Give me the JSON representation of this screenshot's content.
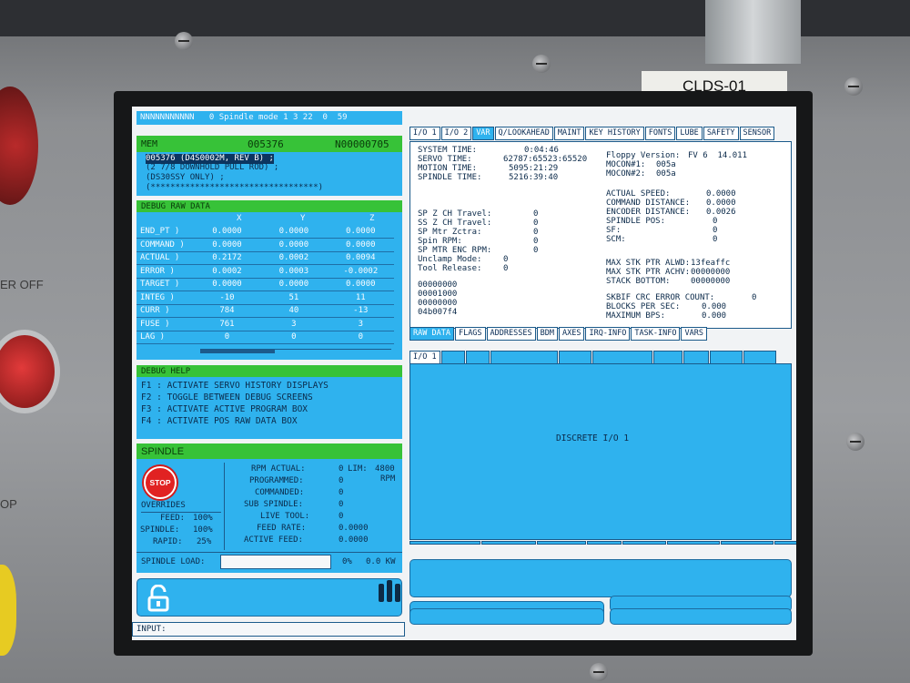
{
  "machine_label": "CLDS-01",
  "external": {
    "side_text_1": "ER OFF",
    "side_text_2": "OP"
  },
  "status_bar": {
    "text": "NNNNNNNNNNN   0 Spindle mode 1 3 22  0  59"
  },
  "program": {
    "mode": "MEM",
    "program_number": "005376",
    "block_number": "N00000705",
    "lines": [
      "005376 (D4S0002M, REV B) ;",
      "(2 7/8 DOWNHOLD PULL ROD) ;",
      "(DS30SSY ONLY) ;",
      "(**********************************)"
    ]
  },
  "debug_raw": {
    "title": "DEBUG RAW DATA",
    "columns": [
      "X",
      "Y",
      "Z"
    ],
    "rows": [
      {
        "label": "END_PT  )",
        "x": "0.0000",
        "y": "0.0000",
        "z": "0.0000"
      },
      {
        "label": "COMMAND )",
        "x": "0.0000",
        "y": "0.0000",
        "z": "0.0000"
      },
      {
        "label": "ACTUAL  )",
        "x": "0.2172",
        "y": "0.0002",
        "z": "0.0094"
      },
      {
        "label": "ERROR   )",
        "x": "0.0002",
        "y": "0.0003",
        "z": "-0.0002"
      },
      {
        "label": "TARGET  )",
        "x": "0.0000",
        "y": "0.0000",
        "z": "0.0000"
      },
      {
        "label": "INTEG   )",
        "x": "-10",
        "y": "51",
        "z": "11"
      },
      {
        "label": "CURR    )",
        "x": "784",
        "y": "40",
        "z": "-13"
      },
      {
        "label": "FUSE    )",
        "x": "761",
        "y": "3",
        "z": "3"
      },
      {
        "label": "LAG     )",
        "x": "0",
        "y": "0",
        "z": "0"
      }
    ]
  },
  "debug_help": {
    "title": "DEBUG HELP",
    "lines": [
      "F1 : ACTIVATE SERVO HISTORY DISPLAYS",
      "F2 : TOGGLE BETWEEN DEBUG SCREENS",
      "F3 : ACTIVATE ACTIVE PROGRAM BOX",
      "F4 : ACTIVATE POS RAW DATA BOX"
    ]
  },
  "spindle": {
    "title": "SPINDLE",
    "stop_label": "STOP",
    "overrides_label": "OVERRIDES",
    "feed_label": "FEED:",
    "feed_value": "100%",
    "spindle_label": "SPINDLE:",
    "spindle_value": "100%",
    "rapid_label": "RAPID:",
    "rapid_value": "25%",
    "rpm_actual_label": "RPM ACTUAL:",
    "rpm_actual_value": "0",
    "lim_label": "LIM:",
    "lim_value": "4800",
    "rpm_unit": "RPM",
    "programmed_label": "PROGRAMMED:",
    "programmed_value": "0",
    "commanded_label": "COMMANDED:",
    "commanded_value": "0",
    "sub_spindle_label": "SUB SPINDLE:",
    "sub_spindle_value": "0",
    "live_tool_label": "LIVE TOOL:",
    "live_tool_value": "0",
    "feed_rate_label": "FEED RATE:",
    "feed_rate_value": "0.0000",
    "active_feed_label": "ACTIVE FEED:",
    "active_feed_value": "0.0000",
    "load_label": "SPINDLE LOAD:",
    "load_percent": "0%",
    "load_kw": "0.0 KW"
  },
  "input": {
    "label": "INPUT:"
  },
  "var_tabs": [
    "I/O 1",
    "I/O 2",
    "VAR",
    "Q/LOOKAHEAD",
    "MAINT",
    "KEY HISTORY",
    "FONTS",
    "LUBE",
    "SAFETY",
    "SENSOR"
  ],
  "var_panel": {
    "system_time_label": "SYSTEM TIME:",
    "system_time": "0:04:46",
    "servo_time_label": "SERVO TIME:",
    "servo_time": "62787:65523:65520",
    "motion_time_label": "MOTION TIME:",
    "motion_time": "5095:21:29",
    "spindle_time_label": "SPINDLE TIME:",
    "spindle_time": "5216:39:40",
    "floppy_label": "Floppy Version:",
    "floppy_value": "FV 6  14.011",
    "mocon1_label": "MOCON#1:",
    "mocon1_value": "005a",
    "mocon2_label": "MOCON#2:",
    "mocon2_value": "005a",
    "actual_speed_label": "ACTUAL SPEED:",
    "actual_speed": "0.0000",
    "command_distance_label": "COMMAND DISTANCE:",
    "command_distance": "0.0000",
    "encoder_distance_label": "ENCODER DISTANCE:",
    "encoder_distance": "0.0026",
    "spindle_pos_label": "SPINDLE POS:",
    "spindle_pos": "0",
    "sf_label": "SF:",
    "sf": "0",
    "scm_label": "SCM:",
    "scm": "0",
    "sp_z_ch_label": "SP Z CH Travel:",
    "sp_z_ch": "0",
    "ss_z_ch_label": "SS Z CH Travel:",
    "ss_z_ch": "0",
    "sp_mtr_label": "SP Mtr Zctra:",
    "sp_mtr": "0",
    "spin_rpm_label": "Spin RPM:",
    "spin_rpm": "0",
    "sp_enc_label": "SP MTR ENC RPM:",
    "sp_enc": "0",
    "unclamp_label": "Unclamp Mode:",
    "unclamp": "0",
    "tool_release_label": "Tool Release:",
    "tool_release": "0",
    "codes": [
      "00000000",
      "00001000",
      "00000000",
      "04b007f4"
    ],
    "max_stk_alwd_label": "MAX STK PTR ALWD:",
    "max_stk_alwd": "13feaffc",
    "max_stk_achv_label": "MAX STK PTR ACHV:",
    "max_stk_achv": "00000000",
    "stack_bottom_label": "STACK BOTTOM:",
    "stack_bottom": "00000000",
    "crc_label": "SKBIF CRC ERROR COUNT:",
    "crc": "0",
    "blocks_label": "BLOCKS PER SEC:",
    "blocks": "0.000",
    "max_bps_label": "MAXIMUM BPS:",
    "max_bps": "0.000"
  },
  "raw_tabs": [
    "RAW DATA",
    "FLAGS",
    "ADDRESSES",
    "BDM",
    "AXES",
    "IRQ-INFO",
    "TASK-INFO",
    "VARS"
  ],
  "io_panel": {
    "tab_label": "I/O 1",
    "title": "DISCRETE I/O 1"
  },
  "colors": {
    "accent_blue": "#2fb2ee",
    "header_green": "#37c238",
    "stop_red": "#e12222"
  }
}
